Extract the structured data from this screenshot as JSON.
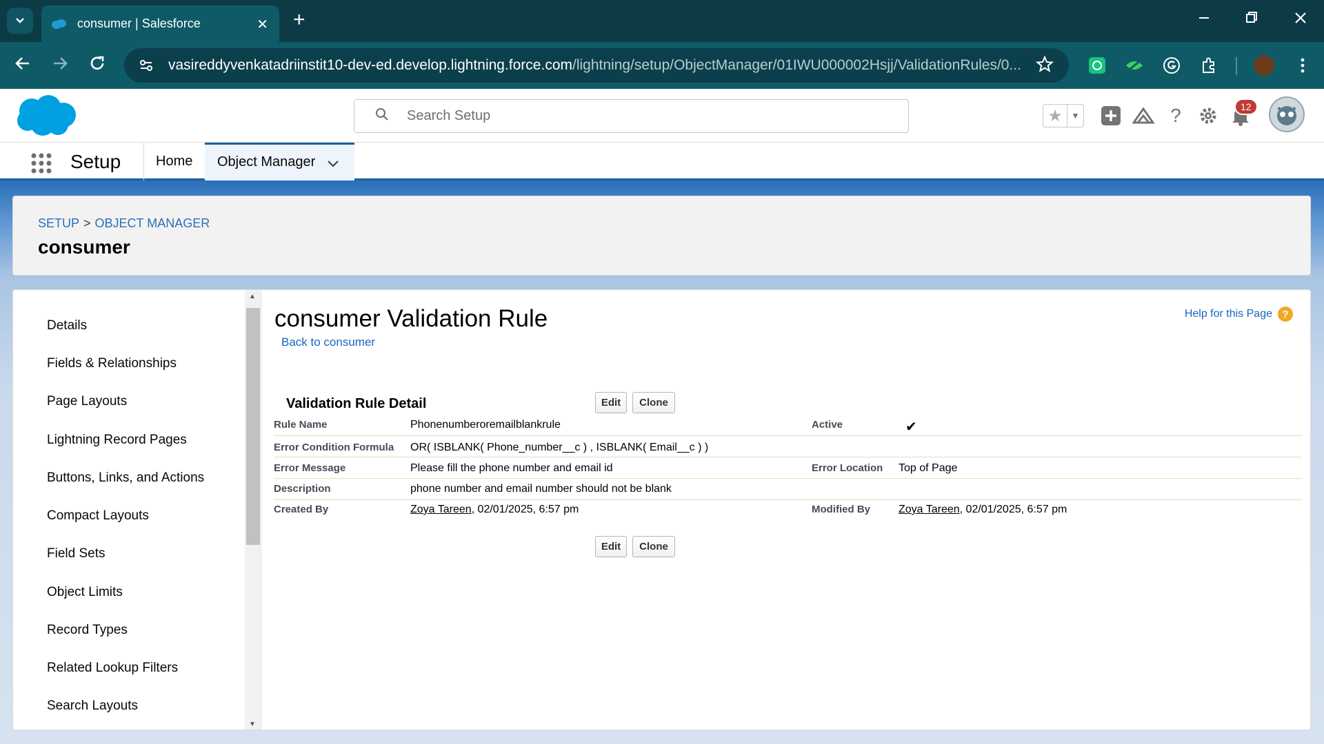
{
  "browser": {
    "tab_title": "consumer | Salesforce",
    "tab_close": "✕",
    "new_tab": "+",
    "url_host": "vasireddyvenkatadriinstit10-dev-ed.develop.lightning.force.com",
    "url_path": "/lightning/setup/ObjectManager/01IWU000002Hsjj/ValidationRules/0...",
    "icons": [
      "tab-list-icon",
      "minimize-icon",
      "restore-icon",
      "close-window-icon",
      "back-icon",
      "forward-icon",
      "reload-icon",
      "site-info-icon",
      "bookmark-star-icon",
      "chatgpt-extension-icon",
      "eye-extension-icon",
      "grammarly-icon",
      "extensions-icon",
      "profile-avatar"
    ]
  },
  "sf_header": {
    "search_placeholder": "Search Setup",
    "notification_count": "12",
    "icons": [
      "favorites-star-icon",
      "favorites-dropdown-icon",
      "global-add-icon",
      "trailhead-icon",
      "help-icon",
      "setup-gear-icon",
      "notification-bell-icon",
      "user-avatar"
    ]
  },
  "nav": {
    "app_name": "Setup",
    "home": "Home",
    "object_manager": "Object Manager"
  },
  "page_header": {
    "crumb_setup": "SETUP",
    "crumb_sep": ">",
    "crumb_om": "OBJECT MANAGER",
    "title": "consumer"
  },
  "sidebar": {
    "items": [
      {
        "label": "Details"
      },
      {
        "label": "Fields & Relationships"
      },
      {
        "label": "Page Layouts"
      },
      {
        "label": "Lightning Record Pages"
      },
      {
        "label": "Buttons, Links, and Actions"
      },
      {
        "label": "Compact Layouts"
      },
      {
        "label": "Field Sets"
      },
      {
        "label": "Object Limits"
      },
      {
        "label": "Record Types"
      },
      {
        "label": "Related Lookup Filters"
      },
      {
        "label": "Search Layouts"
      }
    ]
  },
  "content": {
    "title": "consumer Validation Rule",
    "back_link": "Back to consumer",
    "help_link": "Help for this Page",
    "section_title": "Validation Rule Detail",
    "edit_label": "Edit",
    "clone_label": "Clone",
    "fields": {
      "rule_name_label": "Rule Name",
      "rule_name": "Phonenumberoremailblankrule",
      "active_label": "Active",
      "active_mark": "✔",
      "formula_label": "Error Condition Formula",
      "formula": "OR( ISBLANK( Phone_number__c ) , ISBLANK( Email__c ) )",
      "error_message_label": "Error Message",
      "error_message": "Please fill the phone number and email id",
      "error_location_label": "Error Location",
      "error_location": "Top of Page",
      "description_label": "Description",
      "description": "phone number and email number should not be blank",
      "created_by_label": "Created By",
      "created_by_user": "Zoya Tareen",
      "created_by_date": ", 02/01/2025, 6:57 pm",
      "modified_by_label": "Modified By",
      "modified_by_user": "Zoya Tareen",
      "modified_by_date": ", 02/01/2025, 6:57 pm"
    }
  }
}
